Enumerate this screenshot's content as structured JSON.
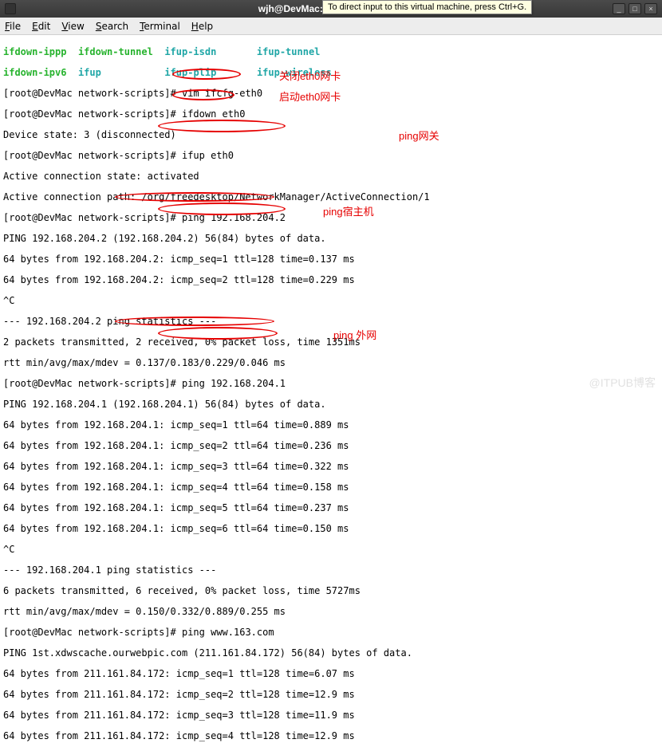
{
  "titlebar": {
    "title": "wjh@DevMac:/etc/syscon",
    "min": "_",
    "max": "□",
    "close": "×"
  },
  "tooltip": "To direct input to this virtual machine, press Ctrl+G.",
  "menu": {
    "file": "File",
    "edit": "Edit",
    "view": "View",
    "search": "Search",
    "terminal": "Terminal",
    "help": "Help"
  },
  "lines": {
    "fn1_0": "ifdown-ippp",
    "fn1_1": "ifdown-tunnel",
    "fn1_2": "ifup-isdn",
    "fn1_3": "ifup-tunnel",
    "fn2_0": "ifdown-ipv6",
    "fn2_1": "ifup",
    "fn2_2": "ifup-plip",
    "fn2_3": "ifup-wireless",
    "prompt": "[root@DevMac network-scripts]# ",
    "cmd_vim": "vim ifcfg-eth0",
    "cmd_ifdown": "ifdown eth0",
    "state_disc": "Device state: 3 (disconnected)",
    "cmd_ifup": "ifup eth0",
    "state_act": "Active connection state: activated",
    "conn_path": "Active connection path: /org/freedesktop/NetworkManager/ActiveConnection/1",
    "cmd_ping1": "ping 192.168.204.2",
    "ping1_head": "PING 192.168.204.2 (192.168.204.2) 56(84) bytes of data.",
    "ping1_l1": "64 bytes from 192.168.204.2: icmp_seq=1 ttl=128 time=0.137 ms",
    "ping1_l2": "64 bytes from 192.168.204.2: icmp_seq=2 ttl=128 time=0.229 ms",
    "ctrlc": "^C",
    "ping1_stat1": "--- 192.168.204.2 ping statistics ---",
    "ping1_stat2": "2 packets transmitted, 2 received, 0% packet loss, time 1351ms",
    "ping1_stat3": "rtt min/avg/max/mdev = 0.137/0.183/0.229/0.046 ms",
    "cmd_ping2": "ping 192.168.204.1",
    "ping2_head": "PING 192.168.204.1 (192.168.204.1) 56(84) bytes of data.",
    "ping2_l1": "64 bytes from 192.168.204.1: icmp_seq=1 ttl=64 time=0.889 ms",
    "ping2_l2": "64 bytes from 192.168.204.1: icmp_seq=2 ttl=64 time=0.236 ms",
    "ping2_l3": "64 bytes from 192.168.204.1: icmp_seq=3 ttl=64 time=0.322 ms",
    "ping2_l4": "64 bytes from 192.168.204.1: icmp_seq=4 ttl=64 time=0.158 ms",
    "ping2_l5": "64 bytes from 192.168.204.1: icmp_seq=5 ttl=64 time=0.237 ms",
    "ping2_l6": "64 bytes from 192.168.204.1: icmp_seq=6 ttl=64 time=0.150 ms",
    "ping2_stat1": "--- 192.168.204.1 ping statistics ---",
    "ping2_stat2": "6 packets transmitted, 6 received, 0% packet loss, time 5727ms",
    "ping2_stat3": "rtt min/avg/max/mdev = 0.150/0.332/0.889/0.255 ms",
    "cmd_ping3": "ping www.163.com",
    "ping3_head": "PING 1st.xdwscache.ourwebpic.com (211.161.84.172) 56(84) bytes of data.",
    "ping3_l1": "64 bytes from 211.161.84.172: icmp_seq=1 ttl=128 time=6.07 ms",
    "ping3_l2": "64 bytes from 211.161.84.172: icmp_seq=2 ttl=128 time=12.9 ms",
    "ping3_l3": "64 bytes from 211.161.84.172: icmp_seq=3 ttl=128 time=11.9 ms",
    "ping3_l4": "64 bytes from 211.161.84.172: icmp_seq=4 ttl=128 time=12.9 ms"
  },
  "annotations": {
    "a1": "关闭eth0网卡",
    "a2": "启动eth0网卡",
    "a3": "ping网关",
    "a4": "ping宿主机",
    "a5": "ping 外网"
  },
  "watermark": "@ITPUB博客"
}
